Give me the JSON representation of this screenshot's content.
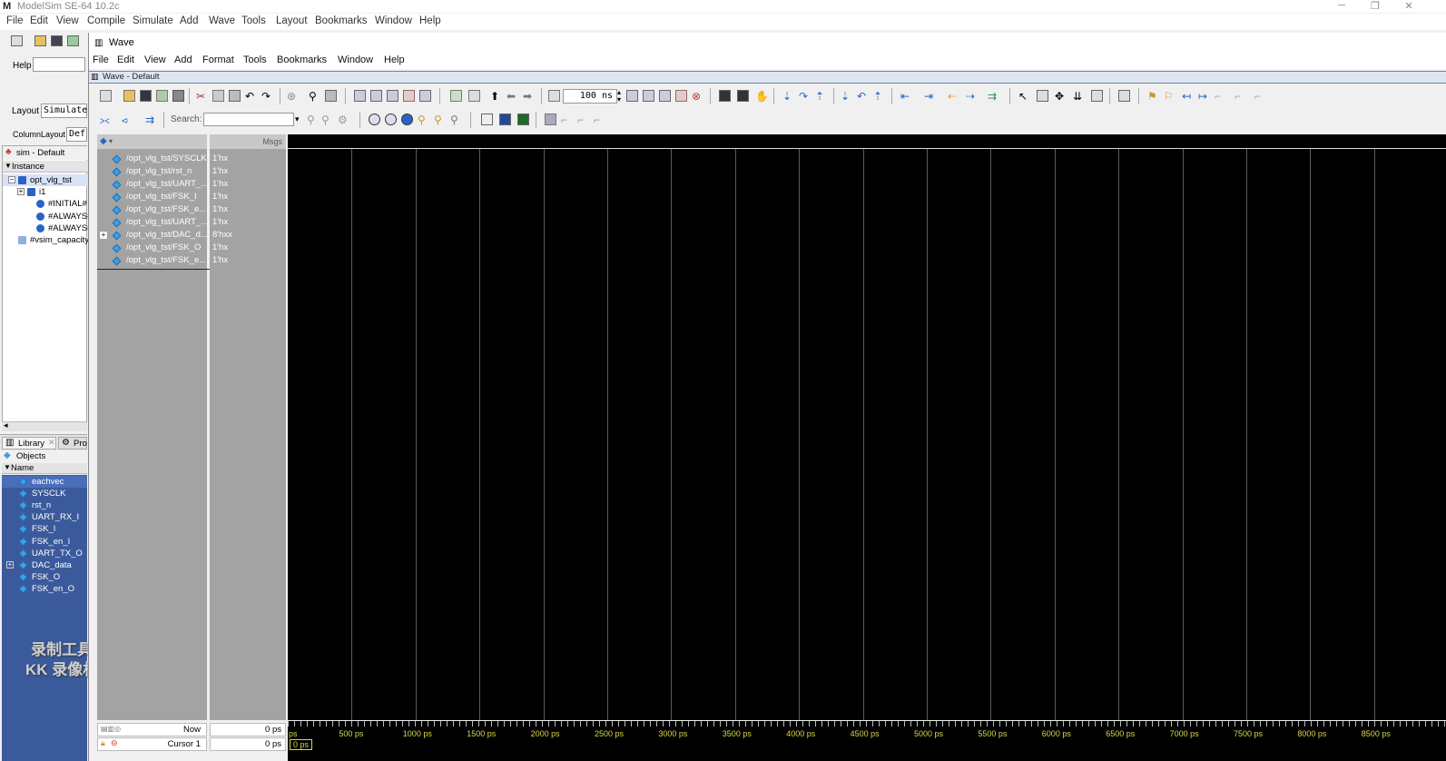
{
  "app": {
    "title": "ModelSim SE-64 10.2c",
    "logo_text": "M",
    "window_controls": [
      "─",
      "❐",
      "✕"
    ]
  },
  "main_menu": [
    "File",
    "Edit",
    "View",
    "Compile",
    "Simulate",
    "Add",
    "Wave",
    "Tools",
    "Layout",
    "Bookmarks",
    "Window",
    "Help"
  ],
  "left_pane": {
    "help_label": "Help",
    "layout_label": "Layout",
    "layout_value": "Simulate",
    "columnlayout_label": "ColumnLayout",
    "columnlayout_value": "Def",
    "sim_tab": "sim - Default",
    "instance_header": "Instance",
    "tree": [
      {
        "label": "opt_vlg_tst",
        "expander": "−"
      },
      {
        "label": "i1",
        "expander": "+"
      },
      {
        "label": "#INITIAL#",
        "expander": ""
      },
      {
        "label": "#ALWAYS#",
        "expander": ""
      },
      {
        "label": "#ALWAYS#",
        "expander": ""
      },
      {
        "label": "#vsim_capacity",
        "expander": ""
      }
    ],
    "bottom_tabs": [
      "Library",
      "Pro"
    ],
    "objects_title": "Objects",
    "objects_header": "Name",
    "objects": [
      {
        "label": "eachvec",
        "expander": ""
      },
      {
        "label": "SYSCLK",
        "expander": ""
      },
      {
        "label": "rst_n",
        "expander": ""
      },
      {
        "label": "UART_RX_I",
        "expander": ""
      },
      {
        "label": "FSK_I",
        "expander": ""
      },
      {
        "label": "FSK_en_I",
        "expander": ""
      },
      {
        "label": "UART_TX_O",
        "expander": ""
      },
      {
        "label": "DAC_data",
        "expander": "+"
      },
      {
        "label": "FSK_O",
        "expander": ""
      },
      {
        "label": "FSK_en_O",
        "expander": ""
      }
    ],
    "watermark_line1": "录制工具",
    "watermark_line2": "KK 录像机"
  },
  "wave_window": {
    "title": "Wave",
    "menu": [
      "File",
      "Edit",
      "View",
      "Add",
      "Format",
      "Tools",
      "Bookmarks",
      "Window",
      "Help"
    ],
    "subtitle": "Wave - Default",
    "run_length": "100 ns",
    "search_label": "Search:",
    "search_value": "",
    "msgs_header": "Msgs",
    "signals": [
      {
        "name": "/opt_vlg_tst/SYSCLK",
        "value": "1'hx",
        "expander": ""
      },
      {
        "name": "/opt_vlg_tst/rst_n",
        "value": "1'hx",
        "expander": ""
      },
      {
        "name": "/opt_vlg_tst/UART_...",
        "value": "1'hx",
        "expander": ""
      },
      {
        "name": "/opt_vlg_tst/FSK_I",
        "value": "1'hx",
        "expander": ""
      },
      {
        "name": "/opt_vlg_tst/FSK_e...",
        "value": "1'hx",
        "expander": ""
      },
      {
        "name": "/opt_vlg_tst/UART_...",
        "value": "1'hx",
        "expander": ""
      },
      {
        "name": "/opt_vlg_tst/DAC_d...",
        "value": "8'hxx",
        "expander": "+"
      },
      {
        "name": "/opt_vlg_tst/FSK_O",
        "value": "1'hx",
        "expander": ""
      },
      {
        "name": "/opt_vlg_tst/FSK_e...",
        "value": "1'hx",
        "expander": ""
      }
    ],
    "now_label": "Now",
    "now_value": "0 ps",
    "cursor_label": "Cursor 1",
    "cursor_value": "0 ps",
    "cursor_marker": "0 ps",
    "time_ticks": [
      "ps",
      "500 ps",
      "1000 ps",
      "1500 ps",
      "2000 ps",
      "2500 ps",
      "3000 ps",
      "3500 ps",
      "4000 ps",
      "4500 ps",
      "5000 ps",
      "5500 ps",
      "6000 ps",
      "6500 ps",
      "7000 ps",
      "7500 ps",
      "8000 ps",
      "8500 ps"
    ]
  }
}
